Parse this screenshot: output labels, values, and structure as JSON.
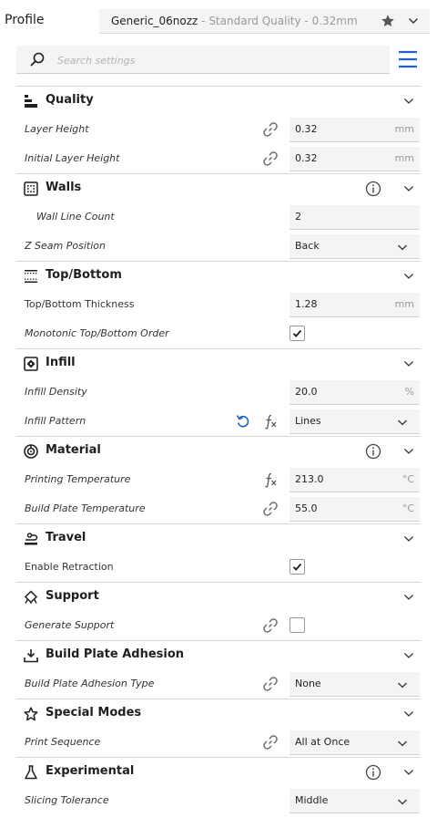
{
  "profile": {
    "label": "Profile",
    "name": "Generic_06nozz",
    "quality_suffix": " - Standard Quality - 0.32mm"
  },
  "search": {
    "placeholder": "Search settings"
  },
  "icons": {
    "accent": "#1f63c8",
    "text": "#1f1f1f",
    "muted": "#7a7a7a"
  },
  "categories": {
    "quality": {
      "title": "Quality",
      "settings": {
        "layer_height": {
          "label": "Layer Height",
          "value": "0.32",
          "unit": "mm"
        },
        "initial_layer_height": {
          "label": "Initial Layer Height",
          "value": "0.32",
          "unit": "mm"
        }
      }
    },
    "walls": {
      "title": "Walls",
      "settings": {
        "wall_line_count": {
          "label": "Wall Line Count",
          "value": "2"
        },
        "z_seam_position": {
          "label": "Z Seam Position",
          "value": "Back"
        }
      }
    },
    "top_bottom": {
      "title": "Top/Bottom",
      "settings": {
        "thickness": {
          "label": "Top/Bottom Thickness",
          "value": "1.28",
          "unit": "mm"
        },
        "monotonic": {
          "label": "Monotonic Top/Bottom Order",
          "checked": true
        }
      }
    },
    "infill": {
      "title": "Infill",
      "settings": {
        "density": {
          "label": "Infill Density",
          "value": "20.0",
          "unit": "%"
        },
        "pattern": {
          "label": "Infill Pattern",
          "value": "Lines"
        }
      }
    },
    "material": {
      "title": "Material",
      "settings": {
        "printing_temp": {
          "label": "Printing Temperature",
          "value": "213.0",
          "unit": "°C"
        },
        "build_plate_temp": {
          "label": "Build Plate Temperature",
          "value": "55.0",
          "unit": "°C"
        }
      }
    },
    "travel": {
      "title": "Travel",
      "settings": {
        "retraction": {
          "label": "Enable Retraction",
          "checked": true
        }
      }
    },
    "support": {
      "title": "Support",
      "settings": {
        "generate_support": {
          "label": "Generate Support",
          "checked": false
        }
      }
    },
    "adhesion": {
      "title": "Build Plate Adhesion",
      "settings": {
        "adhesion_type": {
          "label": "Build Plate Adhesion Type",
          "value": "None"
        }
      }
    },
    "special_modes": {
      "title": "Special Modes",
      "settings": {
        "print_sequence": {
          "label": "Print Sequence",
          "value": "All at Once"
        }
      }
    },
    "experimental": {
      "title": "Experimental",
      "settings": {
        "slicing_tolerance": {
          "label": "Slicing Tolerance",
          "value": "Middle"
        }
      }
    }
  }
}
